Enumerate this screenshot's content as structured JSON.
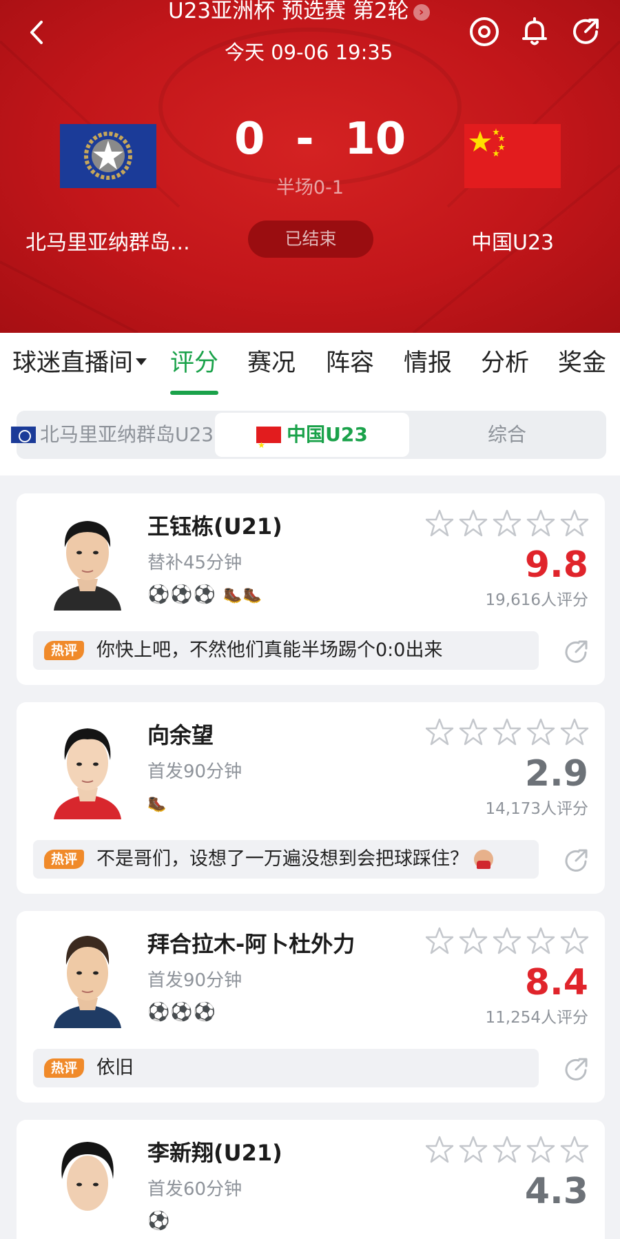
{
  "header": {
    "back_icon": "chevron-left-icon",
    "title": "U23亚洲杯 预选赛 第2轮",
    "time": "今天 09-06 19:35",
    "actions": [
      "target-icon",
      "bell-icon",
      "share-icon"
    ],
    "home_team": "北马里亚纳群岛...",
    "away_team": "中国U23",
    "score": "0  -  10",
    "halftime": "半场0-1",
    "status": "已结束",
    "theme_color": "#c2161a"
  },
  "tabs": [
    {
      "label": "球迷直播间"
    },
    {
      "label": "评分"
    },
    {
      "label": "赛况"
    },
    {
      "label": "阵容"
    },
    {
      "label": "情报"
    },
    {
      "label": "分析"
    },
    {
      "label": "奖金"
    }
  ],
  "active_tab": "评分",
  "team_switch": {
    "options": [
      "北马里亚纳群岛U23",
      "中国U23",
      "综合"
    ],
    "selected": "中国U23",
    "accent": "#1aa24a"
  },
  "players": [
    {
      "name": "王钰栋(U21)",
      "time": "替补45分钟",
      "events": "⚽⚽⚽",
      "boots": "🥾🥾",
      "rating": "9.8",
      "rating_color": "red",
      "count": "19,616人评分",
      "hot_label": "热评",
      "comment": "你快上吧，不然他们真能半场踢个0:0出来"
    },
    {
      "name": "向余望",
      "time": "首发90分钟",
      "events": "",
      "boots": "🥾",
      "rating": "2.9",
      "rating_color": "gray",
      "count": "14,173人评分",
      "hot_label": "热评",
      "comment": "不是哥们，设想了一万遍没想到会把球踩住？"
    },
    {
      "name": "拜合拉木-阿卜杜外力",
      "time": "首发90分钟",
      "events": "⚽⚽⚽",
      "boots": "",
      "rating": "8.4",
      "rating_color": "red",
      "count": "11,254人评分",
      "hot_label": "热评",
      "comment": "依旧"
    },
    {
      "name": "李新翔(U21)",
      "time": "首发60分钟",
      "events": "⚽",
      "boots": "",
      "rating": "4.3",
      "rating_color": "gray",
      "count": "",
      "hot_label": "",
      "comment": ""
    }
  ]
}
